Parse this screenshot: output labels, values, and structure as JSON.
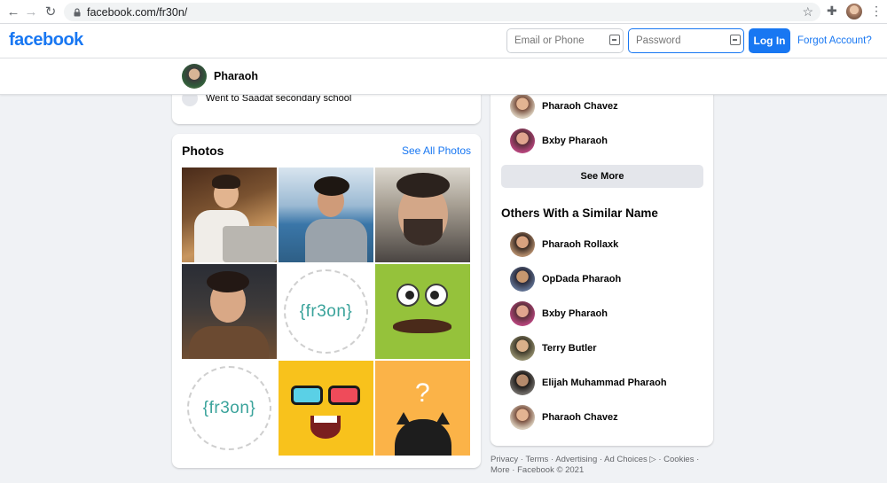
{
  "browser": {
    "url": "facebook.com/fr30n/",
    "back_glyph": "←",
    "forward_glyph": "→",
    "reload_glyph": "↻",
    "star_glyph": "☆",
    "extensions_glyph": "✚",
    "menu_glyph": "⋮"
  },
  "header": {
    "logo": "facebook",
    "email_placeholder": "Email or Phone",
    "password_placeholder": "Password",
    "login_label": "Log In",
    "forgot_label": "Forgot Account?"
  },
  "profile": {
    "name": "Pharaoh"
  },
  "intro": {
    "text": "Went to Saadat secondary school"
  },
  "photos": {
    "title": "Photos",
    "see_all": "See All Photos",
    "logo_text": "{fr3on}"
  },
  "friends": {
    "items": [
      {
        "name": "Pharaoh Chavez"
      },
      {
        "name": "Bxby Pharaoh"
      }
    ],
    "see_more": "See More"
  },
  "similar": {
    "title": "Others With a Similar Name",
    "items": [
      {
        "name": "Pharaoh Rollaxk"
      },
      {
        "name": "OpDada Pharaoh"
      },
      {
        "name": "Bxby Pharaoh"
      },
      {
        "name": "Terry Butler"
      },
      {
        "name": "Elijah Muhammad Pharaoh"
      },
      {
        "name": "Pharaoh Chavez"
      }
    ]
  },
  "footer": {
    "links": [
      "Privacy",
      "Terms",
      "Advertising",
      "Ad Choices ▷",
      "Cookies",
      "More"
    ],
    "copyright": "Facebook © 2021"
  },
  "colors": {
    "brand": "#1877f2",
    "background": "#f0f2f5"
  }
}
